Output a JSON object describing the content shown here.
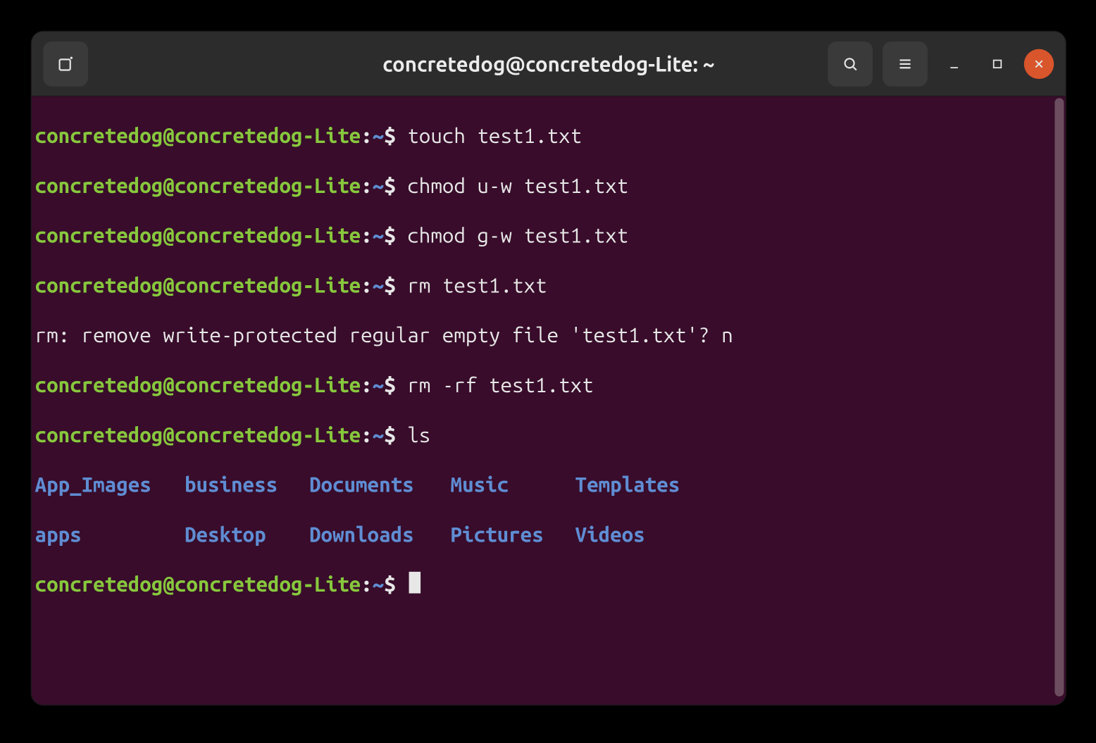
{
  "window": {
    "title": "concretedog@concretedog-Lite: ~"
  },
  "prompt": {
    "user_host": "concretedog@concretedog-Lite",
    "sep1": ":",
    "path": "~",
    "sigil": "$"
  },
  "lines": {
    "cmd0": "touch test1.txt",
    "cmd1": "chmod u-w test1.txt",
    "cmd2": "chmod g-w test1.txt",
    "cmd3": "rm test1.txt",
    "out3": "rm: remove write-protected regular empty file 'test1.txt'? n",
    "cmd4": "rm -rf test1.txt",
    "cmd5": "ls"
  },
  "ls": {
    "row0": [
      "App_Images",
      "business",
      "Documents",
      "Music",
      "Templates"
    ],
    "row1": [
      "apps",
      "Desktop",
      "Downloads",
      "Pictures",
      "Videos"
    ]
  }
}
